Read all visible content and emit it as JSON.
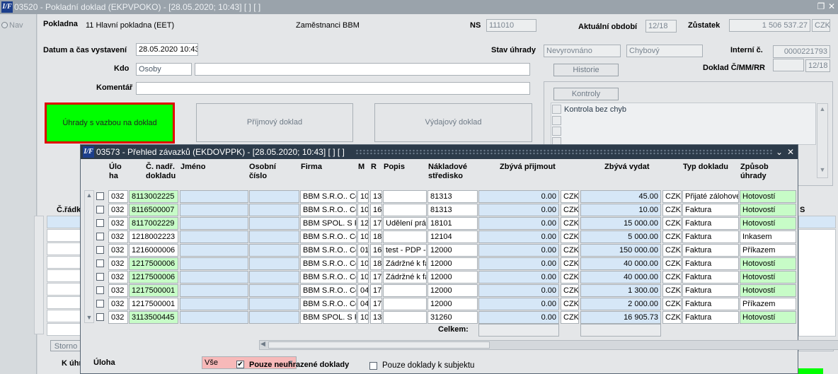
{
  "window": {
    "title": "03520 - Pokladní doklad (EKPVPOKO) - [28.05.2020; 10:43]  [ ]  [ ]",
    "logo": "I/F",
    "restore_icon": "restore-icon",
    "close_icon": "close-icon"
  },
  "nav": {
    "label": "Nav"
  },
  "form": {
    "pokladna_label": "Pokladna",
    "pokladna_value": "11 Hlavní pokladna (EET)",
    "zamestnanci": "Zaměstnanci BBM",
    "ns_label": "NS",
    "ns_value": "111010",
    "obdobi_label": "Aktuální období",
    "obdobi_value": "12/18",
    "zustatek_label": "Zůstatek",
    "zustatek_value": "1 506 537.27",
    "zustatek_currency": "CZK",
    "datum_label": "Datum a čas vystavení",
    "datum_value": "28.05.2020 10:43",
    "stav_label": "Stav úhrady",
    "stav_value1": "Nevyrovnáno",
    "stav_value2": "Chybový",
    "interni_label": "Interní č.",
    "interni_value": "0000221793",
    "kdo_label": "Kdo",
    "kdo_value": "Osoby",
    "kdo_name": "",
    "historie_button": "Historie",
    "doklad_label": "Doklad Č/MM/RR",
    "doklad_number": "",
    "doklad_value": "12/18",
    "komentar_label": "Komentář",
    "komentar_value": "",
    "kontroly_button": "Kontroly",
    "kontrola_text": "Kontrola bez chyb",
    "uhrady_button": "Úhrady s vazbou na doklad",
    "prijmovy_button": "Příjmový doklad",
    "vydajovy_button": "Výdajový doklad",
    "c_radku_label": "Č.řádk",
    "storno_button": "Storno",
    "k_uhr_label": "K úhr",
    "s_label": "S"
  },
  "dialog": {
    "title": "03573 - Přehled závazků (EKDOVPPK) - [28.05.2020; 10:43]  [ ]  [ ]",
    "logo": "I/F",
    "minimize_icon": "minimize-icon",
    "close_icon": "close-icon",
    "columns": [
      "Úlo ha",
      "Č. nadř. dokladu",
      "Jméno",
      "Osobní číslo",
      "Firma",
      "M",
      "R",
      "Popis",
      "Nákladové středisko",
      "Zbývá přijmout",
      "Zbývá vydat",
      "Typ dokladu",
      "Způsob úhrady"
    ],
    "col_ulo": "Úlo",
    "col_ha": "ha",
    "col_c_nadr": "Č. nadř.",
    "col_dokladu": "dokladu",
    "col_jmeno": "Jméno",
    "col_osobni": "Osobní",
    "col_cislo": "číslo",
    "col_firma": "Firma",
    "col_m": "M",
    "col_r": "R",
    "col_popis": "Popis",
    "col_naklad": "Nákladové",
    "col_stredisko": "středisko",
    "col_zbyva_prijmout": "Zbývá přijmout",
    "col_zbyva_vydat": "Zbývá vydat",
    "col_typ": "Typ dokladu",
    "col_zpusob": "Způsob",
    "col_uhrady": "úhrady",
    "rows": [
      {
        "uloha": "032",
        "doklad": "8113002225",
        "jmeno": "",
        "osobni": "",
        "firma": "BBM S.R.O.. Ce",
        "m": "10",
        "r": "13",
        "popis": "",
        "stredisko": "81313",
        "prijmout": "0.00",
        "cur1": "CZK",
        "vydat": "45.00",
        "cur2": "CZK",
        "typ": "Přijaté zálohové",
        "zpusob": "Hotovostí",
        "dg": true,
        "zg": true
      },
      {
        "uloha": "032",
        "doklad": "8116500007",
        "jmeno": "",
        "osobni": "",
        "firma": "BBM S.R.O.. Ce",
        "m": "10",
        "r": "16",
        "popis": "",
        "stredisko": "81313",
        "prijmout": "0.00",
        "cur1": "CZK",
        "vydat": "10.00",
        "cur2": "CZK",
        "typ": "Faktura",
        "zpusob": "Hotovostí",
        "dg": true,
        "zg": true
      },
      {
        "uloha": "032",
        "doklad": "8117002229",
        "jmeno": "",
        "osobni": "",
        "firma": "BBM SPOL. S R",
        "m": "12",
        "r": "17",
        "popis": "Udělení práv",
        "stredisko": "18101",
        "prijmout": "0.00",
        "cur1": "CZK",
        "vydat": "15 000.00",
        "cur2": "CZK",
        "typ": "Faktura",
        "zpusob": "Hotovostí",
        "dg": true,
        "zg": true
      },
      {
        "uloha": "032",
        "doklad": "1218002223",
        "jmeno": "",
        "osobni": "",
        "firma": "BBM S.R.O.. Ce",
        "m": "10",
        "r": "18",
        "popis": "",
        "stredisko": "12104",
        "prijmout": "0.00",
        "cur1": "CZK",
        "vydat": "5 000.00",
        "cur2": "CZK",
        "typ": "Faktura",
        "zpusob": "Inkasem",
        "dg": false,
        "zg": false
      },
      {
        "uloha": "032",
        "doklad": "1216000006",
        "jmeno": "",
        "osobni": "",
        "firma": "BBM S.R.O.. Ce",
        "m": "01",
        "r": "16",
        "popis": "test - PDP -",
        "stredisko": "12000",
        "prijmout": "0.00",
        "cur1": "CZK",
        "vydat": "150 000.00",
        "cur2": "CZK",
        "typ": "Faktura",
        "zpusob": "Příkazem",
        "dg": false,
        "zg": false
      },
      {
        "uloha": "032",
        "doklad": "1217500006",
        "jmeno": "",
        "osobni": "",
        "firma": "BBM S.R.O.. Ce",
        "m": "10",
        "r": "18",
        "popis": "Zádržné k fa",
        "stredisko": "12000",
        "prijmout": "0.00",
        "cur1": "CZK",
        "vydat": "40 000.00",
        "cur2": "CZK",
        "typ": "Faktura",
        "zpusob": "Hotovostí",
        "dg": true,
        "zg": true
      },
      {
        "uloha": "032",
        "doklad": "1217500006",
        "jmeno": "",
        "osobni": "",
        "firma": "BBM S.R.O.. Ce",
        "m": "10",
        "r": "17",
        "popis": "Zádržné k fa",
        "stredisko": "12000",
        "prijmout": "0.00",
        "cur1": "CZK",
        "vydat": "40 000.00",
        "cur2": "CZK",
        "typ": "Faktura",
        "zpusob": "Hotovostí",
        "dg": true,
        "zg": true
      },
      {
        "uloha": "032",
        "doklad": "1217500001",
        "jmeno": "",
        "osobni": "",
        "firma": "BBM S.R.O.. Ce",
        "m": "04",
        "r": "17",
        "popis": "",
        "stredisko": "12000",
        "prijmout": "0.00",
        "cur1": "CZK",
        "vydat": "1 300.00",
        "cur2": "CZK",
        "typ": "Faktura",
        "zpusob": "Hotovostí",
        "dg": true,
        "zg": true
      },
      {
        "uloha": "032",
        "doklad": "1217500001",
        "jmeno": "",
        "osobni": "",
        "firma": "BBM S.R.O.. Ce",
        "m": "04",
        "r": "17",
        "popis": "",
        "stredisko": "12000",
        "prijmout": "0.00",
        "cur1": "CZK",
        "vydat": "2 000.00",
        "cur2": "CZK",
        "typ": "Faktura",
        "zpusob": "Příkazem",
        "dg": false,
        "zg": false
      },
      {
        "uloha": "032",
        "doklad": "3113500445",
        "jmeno": "",
        "osobni": "",
        "firma": "BBM SPOL. S R",
        "m": "10",
        "r": "13",
        "popis": "",
        "stredisko": "31260",
        "prijmout": "0.00",
        "cur1": "CZK",
        "vydat": "16 905.73",
        "cur2": "CZK",
        "typ": "Faktura",
        "zpusob": "Hotovostí",
        "dg": true,
        "zg": true
      }
    ],
    "celkem_label": "Celkem:",
    "celkem_prijmout": "",
    "celkem_vydat": "",
    "uloha_label": "Úloha",
    "uloha_value": "Vše",
    "neuhrazene_label": "Pouze neuhrazené doklady",
    "neuhrazene_checked": true,
    "k_subjektu_label": "Pouze doklady k subjektu",
    "k_subjektu_checked": false
  }
}
